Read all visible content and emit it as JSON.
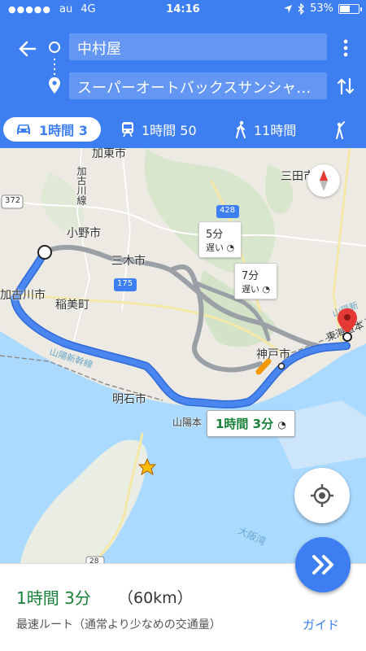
{
  "status_bar": {
    "carrier": "au",
    "network": "4G",
    "time": "14:16",
    "battery": "53%",
    "battery_level": 0.53
  },
  "header": {
    "origin": "中村屋",
    "destination": "スーパーオートバックスサンシャ…"
  },
  "modes": {
    "car": "1時間 3",
    "transit": "1時間 50",
    "walk": "11時間"
  },
  "map": {
    "labels": {
      "kato": "加東市",
      "kakogawa_line": "加古川線",
      "sanda": "三田市",
      "ono": "小野市",
      "miki": "三木市",
      "kakogawa_city": "加古川市",
      "inami": "稲美町",
      "kobe": "神戸市",
      "akashi": "明石市",
      "sanyo_line": "山陽新幹線",
      "sanyo_main": "山陽本",
      "tokaido": "東海道本",
      "sanyo_shin": "山陽新",
      "osaka_bay": "大阪湾",
      "road_372": "372",
      "road_428": "428",
      "road_175": "175",
      "road_28": "28"
    },
    "callouts": {
      "alt1_time": "5分",
      "alt1_note": "遅い",
      "alt2_time": "7分",
      "alt2_note": "遅い",
      "main_time": "1時間 3分"
    }
  },
  "sheet": {
    "time": "1時間 3分",
    "distance": "（60km）",
    "note": "最速ルート（通常より少なめの交通量）",
    "guide": "ガイド"
  },
  "colors": {
    "accent": "#3d7ef0",
    "route_main": "#4a86f0",
    "route_alt": "#9aa0a6",
    "fast_green": "#188038",
    "destination_pin": "#e53935"
  }
}
